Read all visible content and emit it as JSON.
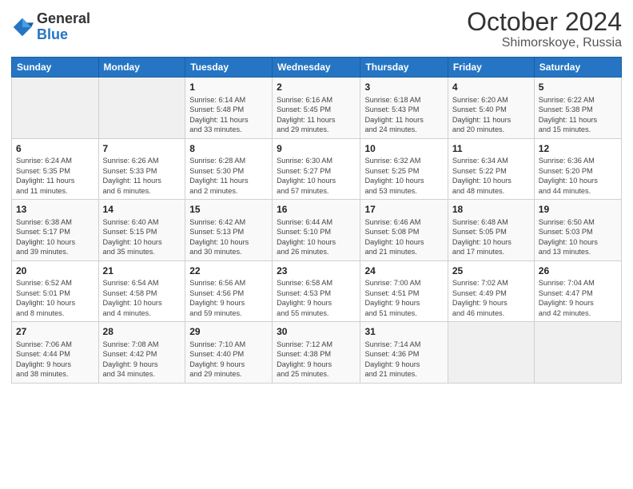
{
  "logo": {
    "general": "General",
    "blue": "Blue"
  },
  "title": "October 2024",
  "subtitle": "Shimorskoye, Russia",
  "header_days": [
    "Sunday",
    "Monday",
    "Tuesday",
    "Wednesday",
    "Thursday",
    "Friday",
    "Saturday"
  ],
  "weeks": [
    [
      {
        "day": "",
        "info": ""
      },
      {
        "day": "",
        "info": ""
      },
      {
        "day": "1",
        "info": "Sunrise: 6:14 AM\nSunset: 5:48 PM\nDaylight: 11 hours\nand 33 minutes."
      },
      {
        "day": "2",
        "info": "Sunrise: 6:16 AM\nSunset: 5:45 PM\nDaylight: 11 hours\nand 29 minutes."
      },
      {
        "day": "3",
        "info": "Sunrise: 6:18 AM\nSunset: 5:43 PM\nDaylight: 11 hours\nand 24 minutes."
      },
      {
        "day": "4",
        "info": "Sunrise: 6:20 AM\nSunset: 5:40 PM\nDaylight: 11 hours\nand 20 minutes."
      },
      {
        "day": "5",
        "info": "Sunrise: 6:22 AM\nSunset: 5:38 PM\nDaylight: 11 hours\nand 15 minutes."
      }
    ],
    [
      {
        "day": "6",
        "info": "Sunrise: 6:24 AM\nSunset: 5:35 PM\nDaylight: 11 hours\nand 11 minutes."
      },
      {
        "day": "7",
        "info": "Sunrise: 6:26 AM\nSunset: 5:33 PM\nDaylight: 11 hours\nand 6 minutes."
      },
      {
        "day": "8",
        "info": "Sunrise: 6:28 AM\nSunset: 5:30 PM\nDaylight: 11 hours\nand 2 minutes."
      },
      {
        "day": "9",
        "info": "Sunrise: 6:30 AM\nSunset: 5:27 PM\nDaylight: 10 hours\nand 57 minutes."
      },
      {
        "day": "10",
        "info": "Sunrise: 6:32 AM\nSunset: 5:25 PM\nDaylight: 10 hours\nand 53 minutes."
      },
      {
        "day": "11",
        "info": "Sunrise: 6:34 AM\nSunset: 5:22 PM\nDaylight: 10 hours\nand 48 minutes."
      },
      {
        "day": "12",
        "info": "Sunrise: 6:36 AM\nSunset: 5:20 PM\nDaylight: 10 hours\nand 44 minutes."
      }
    ],
    [
      {
        "day": "13",
        "info": "Sunrise: 6:38 AM\nSunset: 5:17 PM\nDaylight: 10 hours\nand 39 minutes."
      },
      {
        "day": "14",
        "info": "Sunrise: 6:40 AM\nSunset: 5:15 PM\nDaylight: 10 hours\nand 35 minutes."
      },
      {
        "day": "15",
        "info": "Sunrise: 6:42 AM\nSunset: 5:13 PM\nDaylight: 10 hours\nand 30 minutes."
      },
      {
        "day": "16",
        "info": "Sunrise: 6:44 AM\nSunset: 5:10 PM\nDaylight: 10 hours\nand 26 minutes."
      },
      {
        "day": "17",
        "info": "Sunrise: 6:46 AM\nSunset: 5:08 PM\nDaylight: 10 hours\nand 21 minutes."
      },
      {
        "day": "18",
        "info": "Sunrise: 6:48 AM\nSunset: 5:05 PM\nDaylight: 10 hours\nand 17 minutes."
      },
      {
        "day": "19",
        "info": "Sunrise: 6:50 AM\nSunset: 5:03 PM\nDaylight: 10 hours\nand 13 minutes."
      }
    ],
    [
      {
        "day": "20",
        "info": "Sunrise: 6:52 AM\nSunset: 5:01 PM\nDaylight: 10 hours\nand 8 minutes."
      },
      {
        "day": "21",
        "info": "Sunrise: 6:54 AM\nSunset: 4:58 PM\nDaylight: 10 hours\nand 4 minutes."
      },
      {
        "day": "22",
        "info": "Sunrise: 6:56 AM\nSunset: 4:56 PM\nDaylight: 9 hours\nand 59 minutes."
      },
      {
        "day": "23",
        "info": "Sunrise: 6:58 AM\nSunset: 4:53 PM\nDaylight: 9 hours\nand 55 minutes."
      },
      {
        "day": "24",
        "info": "Sunrise: 7:00 AM\nSunset: 4:51 PM\nDaylight: 9 hours\nand 51 minutes."
      },
      {
        "day": "25",
        "info": "Sunrise: 7:02 AM\nSunset: 4:49 PM\nDaylight: 9 hours\nand 46 minutes."
      },
      {
        "day": "26",
        "info": "Sunrise: 7:04 AM\nSunset: 4:47 PM\nDaylight: 9 hours\nand 42 minutes."
      }
    ],
    [
      {
        "day": "27",
        "info": "Sunrise: 7:06 AM\nSunset: 4:44 PM\nDaylight: 9 hours\nand 38 minutes."
      },
      {
        "day": "28",
        "info": "Sunrise: 7:08 AM\nSunset: 4:42 PM\nDaylight: 9 hours\nand 34 minutes."
      },
      {
        "day": "29",
        "info": "Sunrise: 7:10 AM\nSunset: 4:40 PM\nDaylight: 9 hours\nand 29 minutes."
      },
      {
        "day": "30",
        "info": "Sunrise: 7:12 AM\nSunset: 4:38 PM\nDaylight: 9 hours\nand 25 minutes."
      },
      {
        "day": "31",
        "info": "Sunrise: 7:14 AM\nSunset: 4:36 PM\nDaylight: 9 hours\nand 21 minutes."
      },
      {
        "day": "",
        "info": ""
      },
      {
        "day": "",
        "info": ""
      }
    ]
  ]
}
